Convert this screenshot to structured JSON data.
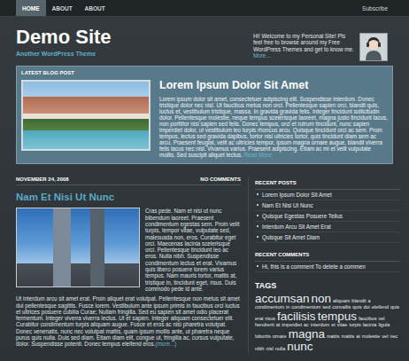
{
  "nav": {
    "items": [
      {
        "label": "HOME",
        "selected": true
      },
      {
        "label": "ABOUT",
        "selected": false
      },
      {
        "label": "ABOUT",
        "selected": false
      }
    ],
    "subscribe": "Subscribe"
  },
  "header": {
    "title": "Demo Site",
    "tagline": "Another WordPress Theme",
    "welcome": "Hi! Welcome to my Personal Site! Pls feel free to browse around my Free WordPress Themes and get to know me.",
    "welcome_link": "More..."
  },
  "featured": {
    "label": "LATEST BLOG POST",
    "title": "Lorem Ipsum Dolor Sit Amet",
    "body": "Lorem ipsum dolor sit amet, consectetuer adipiscing elit. Suspendisse interdum. Donec tristique dolor nec nisl. Ut faucibus metus non orci. Pellentesque sapien orci, blandit quis, luctus et, vestibulum tristique, massa. In gravida gravida felis. Integer tincidunt sollicitudin dolor. Pellentesque molestie, neque tempus scelerisque laoreet, magna justo tincidunt lacus, non porttitor nisi sapien sed felis. Donec tempus, orci et rutrum tincidunt, nunc sapien imperdiet dolor, ut vestibulum leo turpis rhoncus arcu. Quisque tincidunt orci ac sem. Proin tempus, lectus sed gravida dapibus, tortor nisi ultricies tortor, quis tincidunt diam sem ac arcu. Praesent feugiat, velit ac ultricies tempor, ipsum magna ornare augue, blandit viverra felis lacus nec nisl. Vivamus varius. Praesent adipiscing. Etiam ac mi et velit vulputate mollis. Sed suscipit aliquet lectus.",
    "more": "Read More"
  },
  "post": {
    "date": "NOVEMBER 24, 2008",
    "comments": "NO COMMENTS",
    "title": "Nam Et Nisi Ut Nunc",
    "paragraphs": [
      "Cras pede. Nam et nisi ut nunc bibendum laoreet. Praesent condimentum egestas sem. Proin velit turpis, tempor vitae, vulputate sed, malesuada non, eros. Curabitur eget orci. Maecenas lacinia scelerisque orci. Pellentesque tincidunt leo ac eros. Nulla nibh. Suspendisse condimentum lectus et erat. Vivamus quis libero posuere lorem varius tempus. Nam mauris tortor, mattis at, tristique in, tincidunt eget, risus. Duis commodo pede id ante.",
      "Ut interdum arcu sit amet erat. Proin aliquet erat volutpat. Pellentesque non metus sit amet dui pellentesque sagittis. Fusce lorem. Vestibulum ante ipsum primis in faucibus orci luctus et ultrices posuere cubilia Curae; Nullam fringilla. Sed eu sapien sit amet odio placerat fermentum. Integer viverra viverra lectus. Ut et sapien. Integer aliquam consectetuer elit. Curabitur condimentum turpis aliquam augue. Fusce et eros ac nisi pharetra volutpat. Donec venenatis, nunc nec volutpat mattis, quam ipsum mollis ante, ut pharetra neque purus quis nulla. Duis sed diam. Etiam diam elit, congue ut, fringilla ac, cursus vulputate, dolor. Suspendisse potenti. Donec tempus eleifend eros."
    ],
    "more": "(more...)"
  },
  "sidebar": {
    "recent_posts": {
      "title": "RECENT POSTS",
      "items": [
        "Lorem Ipsum Dolor Sit Amet",
        "Nam Et Nisi Ut Nunc",
        "Quisque Egestas Posuere Tellus",
        "Interdum Arcu Sit Amet Erat",
        "Quisque Sit Amet Diam"
      ]
    },
    "recent_comments": {
      "title": "RECENT COMMENTS",
      "items": [
        "Hi, this is a comment To delete a commen"
      ]
    },
    "tags": {
      "title": "TAGS",
      "items": [
        {
          "label": "accumsan",
          "kind": "big"
        },
        {
          "label": "non",
          "kind": "big"
        },
        {
          "label": "aliquam",
          "kind": "small"
        },
        {
          "label": "blandit",
          "kind": "small"
        },
        {
          "label": "a",
          "kind": "small"
        },
        {
          "label": "condimentum",
          "kind": "small"
        },
        {
          "label": "in",
          "kind": "small"
        },
        {
          "label": "condimentum",
          "kind": "small"
        },
        {
          "label": "sed",
          "kind": "small"
        },
        {
          "label": "convallis",
          "kind": "small"
        },
        {
          "label": "quis",
          "kind": "small"
        },
        {
          "label": "dui",
          "kind": "small"
        },
        {
          "label": "eleifend",
          "kind": "small"
        },
        {
          "label": "quis",
          "kind": "small"
        },
        {
          "label": "erat",
          "kind": "small"
        },
        {
          "label": "risus",
          "kind": "small"
        },
        {
          "label": "facilisis",
          "kind": "big"
        },
        {
          "label": "tempus",
          "kind": "big"
        },
        {
          "label": "faucibus",
          "kind": "small"
        },
        {
          "label": "vel",
          "kind": "small"
        },
        {
          "label": "hendrerit",
          "kind": "small"
        },
        {
          "label": "at",
          "kind": "small"
        },
        {
          "label": "imperdiet",
          "kind": "small"
        },
        {
          "label": "ac",
          "kind": "small"
        },
        {
          "label": "interdum",
          "kind": "small"
        },
        {
          "label": "et",
          "kind": "small"
        },
        {
          "label": "vitae",
          "kind": "small"
        },
        {
          "label": "turpis",
          "kind": "small"
        },
        {
          "label": "lacinia",
          "kind": "small"
        },
        {
          "label": "ligula",
          "kind": "small"
        },
        {
          "label": "lobortis",
          "kind": "small"
        },
        {
          "label": "ornare",
          "kind": "small"
        },
        {
          "label": "magna",
          "kind": "big"
        },
        {
          "label": "mattis",
          "kind": "small"
        },
        {
          "label": "mattis",
          "kind": "small"
        },
        {
          "label": "at",
          "kind": "small"
        },
        {
          "label": "molestie",
          "kind": "small"
        },
        {
          "label": "vel",
          "kind": "small"
        },
        {
          "label": "nec",
          "kind": "small"
        },
        {
          "label": "nibh",
          "kind": "small"
        },
        {
          "label": "nisl",
          "kind": "small"
        },
        {
          "label": "nulla",
          "kind": "small"
        },
        {
          "label": "nunc",
          "kind": "big"
        }
      ]
    }
  }
}
